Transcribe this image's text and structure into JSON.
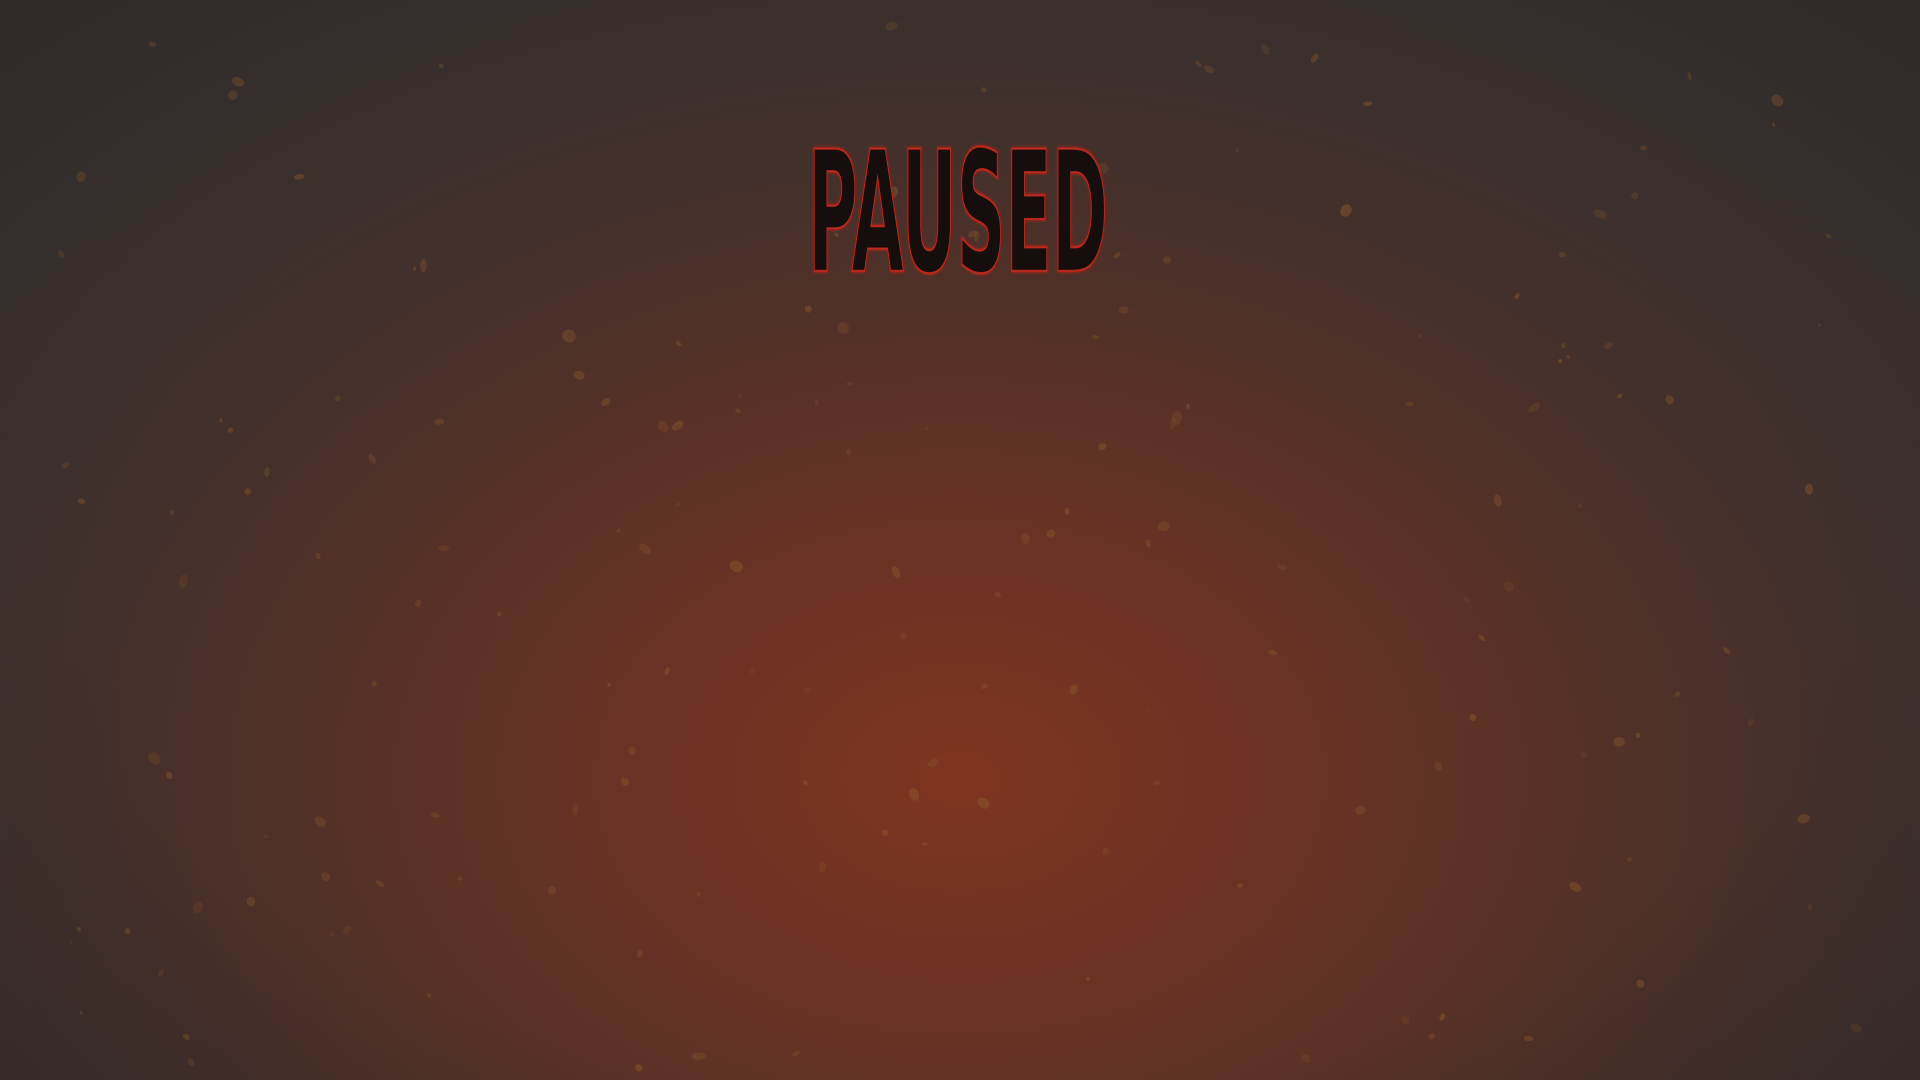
{
  "pause_screen": {
    "title": "PAUSED",
    "title_colors": {
      "fill": "#140808",
      "outline": "#b0271c",
      "inner_stripe": "#c2311f"
    }
  },
  "background": {
    "center_color": "#7f3421",
    "edge_color": "#3a3230",
    "particle_color": "#8a5a2c"
  }
}
